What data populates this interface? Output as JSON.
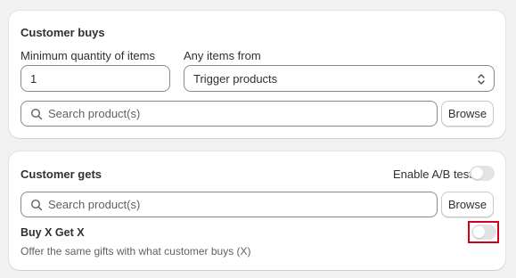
{
  "customer_buys": {
    "title": "Customer buys",
    "min_qty_label": "Minimum quantity of items",
    "min_qty_value": "1",
    "any_items_label": "Any items from",
    "any_items_selected": "Trigger products",
    "search_placeholder": "Search product(s)",
    "browse_label": "Browse"
  },
  "customer_gets": {
    "title": "Customer gets",
    "ab_test_label": "Enable A/B test",
    "ab_test_enabled": false,
    "search_placeholder": "Search product(s)",
    "browse_label": "Browse",
    "bxgx_label": "Buy X Get X",
    "bxgx_description": "Offer the same gifts with what customer buys (X)",
    "bxgx_enabled": false
  },
  "colors": {
    "highlight": "#d0021b",
    "toggle_off": "#e3e3e3"
  }
}
